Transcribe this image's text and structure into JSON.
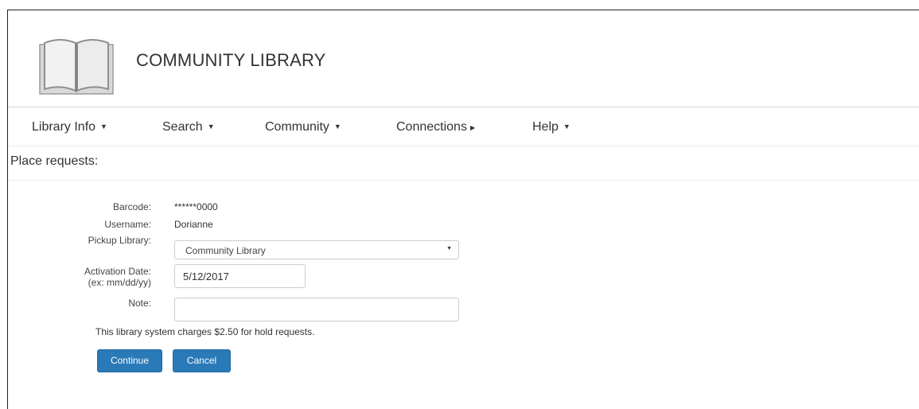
{
  "header": {
    "title": "COMMUNITY LIBRARY",
    "logo_icon": "open-book-icon"
  },
  "nav": {
    "items": [
      {
        "label": "Library Info",
        "indicator": "caret-down"
      },
      {
        "label": "Search",
        "indicator": "caret-down"
      },
      {
        "label": "Community",
        "indicator": "caret-down"
      },
      {
        "label": "Connections",
        "indicator": "caret-right"
      },
      {
        "label": "Help",
        "indicator": "caret-down"
      }
    ]
  },
  "page": {
    "title": "Place requests:"
  },
  "form": {
    "barcode_label": "Barcode:",
    "barcode_value": "******0000",
    "username_label": "Username:",
    "username_value": "Dorianne",
    "pickup_label": "Pickup Library:",
    "pickup_value": "Community Library",
    "activation_label_line1": "Activation Date:",
    "activation_label_line2": "(ex: mm/dd/yy)",
    "activation_value": "5/12/2017",
    "note_label": "Note:",
    "note_value": "",
    "notice": "This library system charges $2.50 for hold requests.",
    "continue_label": "Continue",
    "cancel_label": "Cancel"
  },
  "colors": {
    "button": "#2a7ab8",
    "text": "#333333",
    "divider": "#cfd4d8"
  }
}
